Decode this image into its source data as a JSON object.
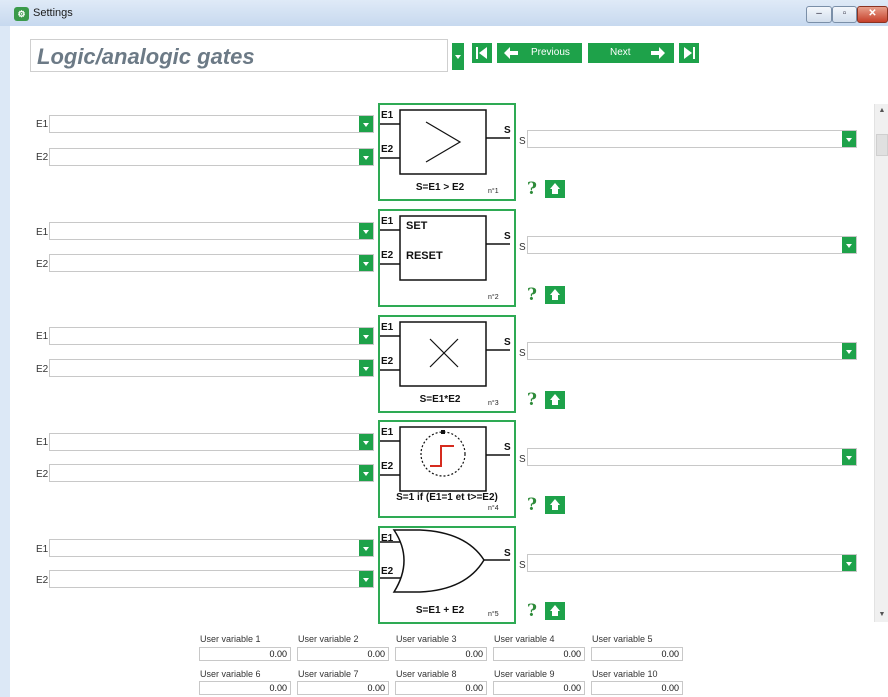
{
  "window": {
    "title": "Settings",
    "app_icon": "settings-app-icon"
  },
  "header": {
    "page_title": "Logic/analogic gates",
    "nav": {
      "previous": "Previous",
      "next": "Next"
    }
  },
  "colors": {
    "accent": "#1ea24a",
    "gate_border": "#2eaa54",
    "timer_red": "#d62b1e"
  },
  "gates": [
    {
      "in1_label": "E1",
      "in2_label": "E2",
      "out_label": "S",
      "block_in1": "E1",
      "block_in2": "E2",
      "block_out": "S",
      "formula": "S=E1 > E2",
      "number": "n°1",
      "symbol": "greater-than",
      "help": "?"
    },
    {
      "in1_label": "E1",
      "in2_label": "E2",
      "out_label": "S",
      "block_in1": "E1",
      "block_in2": "E2",
      "block_out": "S",
      "set_text": "SET",
      "reset_text": "RESET",
      "formula": "",
      "number": "n°2",
      "symbol": "set-reset",
      "help": "?"
    },
    {
      "in1_label": "E1",
      "in2_label": "E2",
      "out_label": "S",
      "block_in1": "E1",
      "block_in2": "E2",
      "block_out": "S",
      "formula": "S=E1*E2",
      "number": "n°3",
      "symbol": "multiply",
      "help": "?"
    },
    {
      "in1_label": "E1",
      "in2_label": "E2",
      "out_label": "S",
      "block_in1": "E1",
      "block_in2": "E2",
      "block_out": "S",
      "formula": "S=1 if (E1=1 et t>=E2)",
      "number": "n°4",
      "symbol": "timer",
      "help": "?"
    },
    {
      "in1_label": "E1",
      "in2_label": "E2",
      "out_label": "S",
      "block_in1": "E1",
      "block_in2": "E2",
      "block_out": "S",
      "formula": "S=E1 + E2",
      "number": "n°5",
      "symbol": "or-gate",
      "help": "?"
    }
  ],
  "user_variables": [
    {
      "label": "User variable 1",
      "value": "0.00"
    },
    {
      "label": "User variable 2",
      "value": "0.00"
    },
    {
      "label": "User variable 3",
      "value": "0.00"
    },
    {
      "label": "User variable 4",
      "value": "0.00"
    },
    {
      "label": "User variable 5",
      "value": "0.00"
    },
    {
      "label": "User variable 6",
      "value": "0.00"
    },
    {
      "label": "User variable 7",
      "value": "0.00"
    },
    {
      "label": "User variable 8",
      "value": "0.00"
    },
    {
      "label": "User variable 9",
      "value": "0.00"
    },
    {
      "label": "User variable 10",
      "value": "0.00"
    }
  ]
}
